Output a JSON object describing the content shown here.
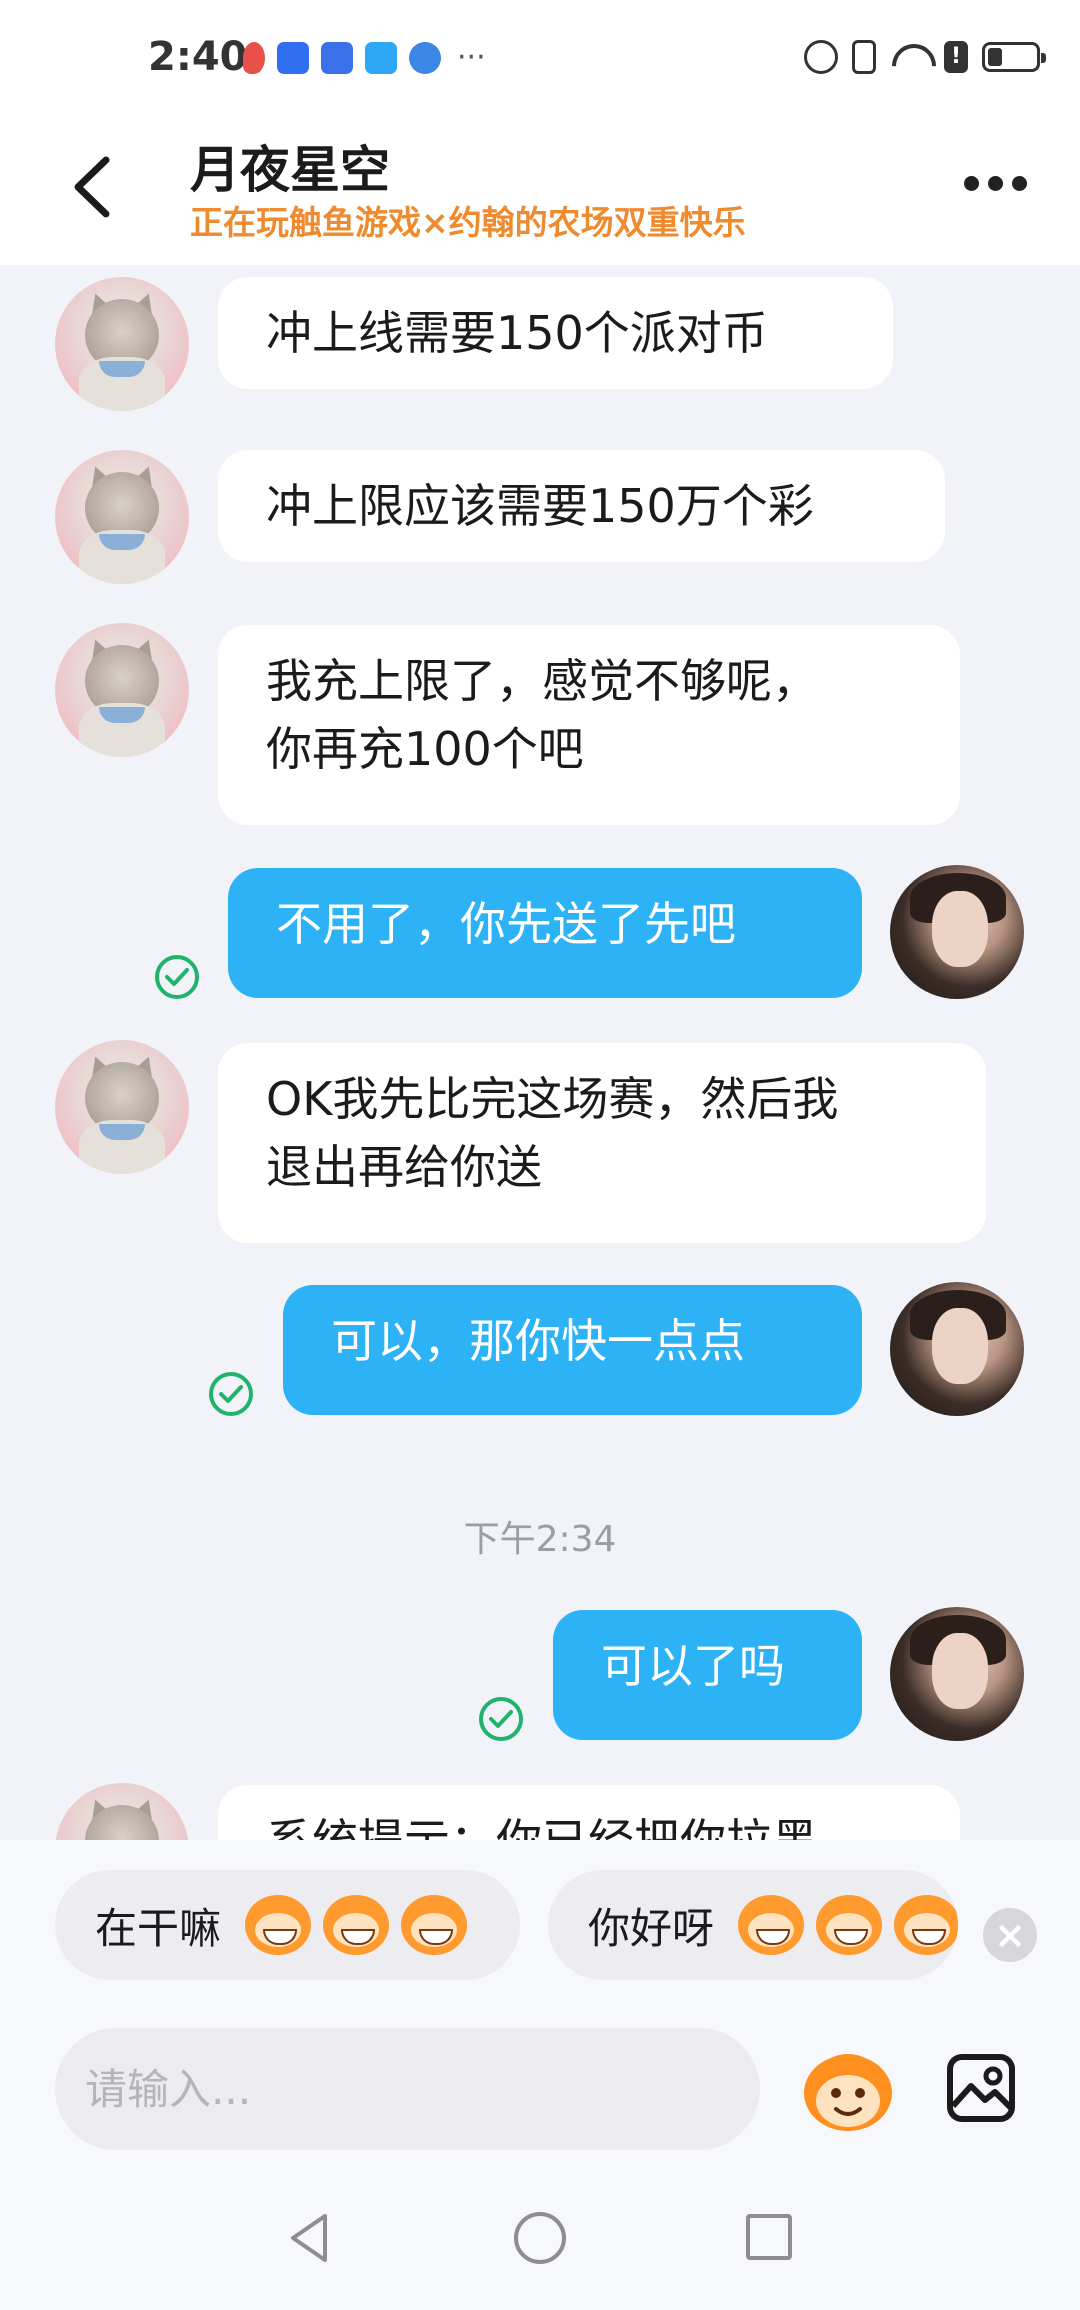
{
  "status_bar": {
    "time": "2:40",
    "dots": "···"
  },
  "header": {
    "contact_name": "月夜星空",
    "contact_status": "正在玩触鱼游戏×约翰的农场双重快乐"
  },
  "messages": [
    {
      "direction": "in",
      "text": "冲上线需要150个派对币"
    },
    {
      "direction": "in",
      "text": "冲上限应该需要150万个彩"
    },
    {
      "direction": "in",
      "text": "我充上限了，感觉不够呢，\n你再充100个吧"
    },
    {
      "direction": "out",
      "text": "不用了，你先送了先吧",
      "status": "read"
    },
    {
      "direction": "in",
      "text": "OK我先比完这场赛，然后我\n退出再给你送"
    },
    {
      "direction": "out",
      "text": "可以，那你快一点点",
      "status": "read"
    },
    {
      "direction": "out",
      "text": "可以了吗",
      "status": "read"
    },
    {
      "direction": "in",
      "text": "系统提示：你已经把你拉黑"
    }
  ],
  "time_separator": "下午2:34",
  "quick_replies": [
    {
      "label": "在干嘛",
      "emoji": "grinning-monkey-emoji"
    },
    {
      "label": "你好呀",
      "emoji": "smiling-monkey-emoji"
    }
  ],
  "input": {
    "placeholder": "请输入..."
  },
  "colors": {
    "accent": "#2cb2f5",
    "status_text": "#ef8a2e",
    "read_check": "#20b36b",
    "chat_bg": "#f1f3f9"
  }
}
